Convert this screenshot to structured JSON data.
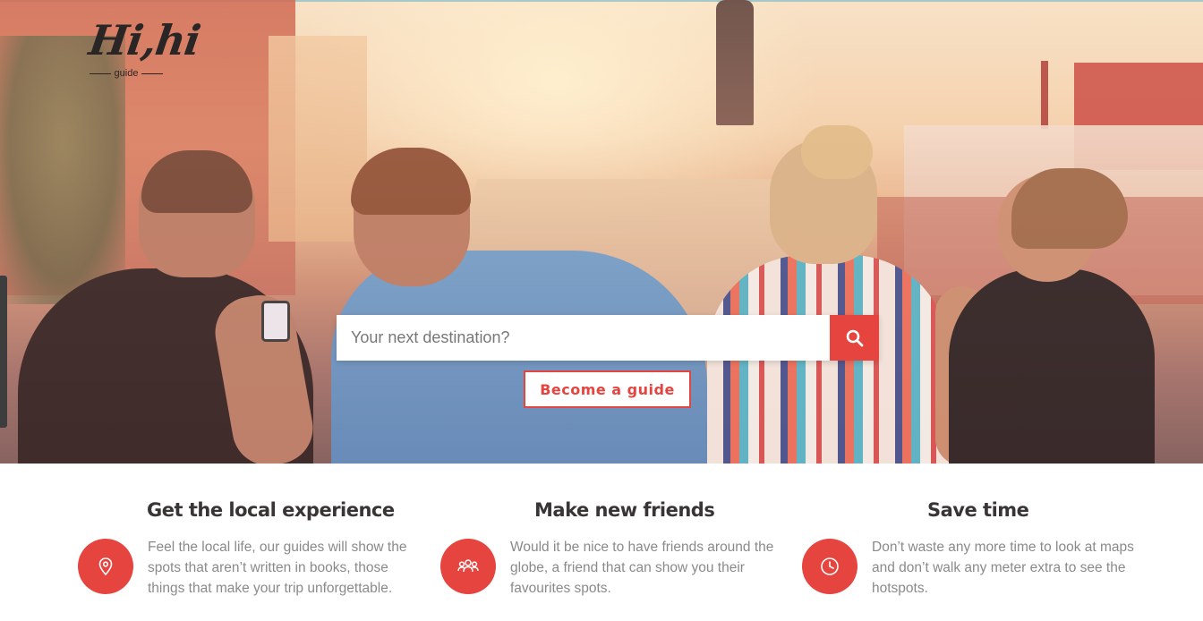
{
  "brand": {
    "logo_main": "Hi,hi",
    "logo_sub": "guide"
  },
  "search": {
    "placeholder": "Your next destination?",
    "icon": "search-icon"
  },
  "cta": {
    "become_guide": "Become a guide"
  },
  "features": [
    {
      "title": "Get the local experience",
      "icon": "map-pin-icon",
      "text": "Feel the local life, our guides will show the spots that aren’t written in books, those things that make your trip unforgettable."
    },
    {
      "title": "Make new friends",
      "icon": "group-icon",
      "text": "Would it be nice to have friends around the globe, a friend that can show you their favourites spots."
    },
    {
      "title": "Save time",
      "icon": "clock-icon",
      "text": "Don’t waste any more time to look at maps and don’t walk any meter extra to see the hotspots."
    }
  ],
  "colors": {
    "accent": "#e6443f",
    "heading": "#3a3535",
    "body_text": "#8a8a8a"
  }
}
